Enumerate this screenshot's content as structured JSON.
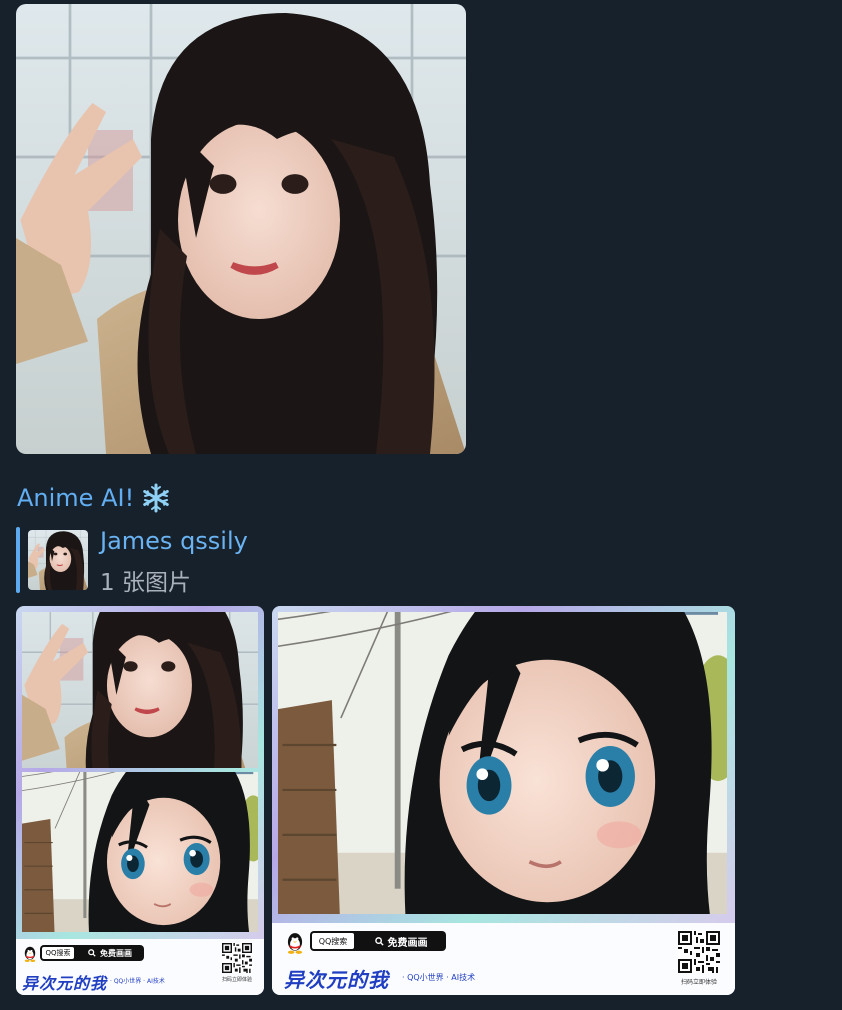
{
  "message": {
    "sender_name": "Anime AI!",
    "sender_emoji": "snowflake-icon"
  },
  "reply": {
    "author": "James qssily",
    "text": "1 张图片"
  },
  "card": {
    "pill_label": "QQ搜索",
    "pill_button": "免费画画",
    "brand": "异次元的我",
    "brand_sub": "· QQ小世界 · AI技术",
    "qr_label": "扫码立即体验"
  },
  "colors": {
    "background": "#17212b",
    "link": "#62aef2",
    "reply_bar": "#5eaaf0",
    "muted": "#a9b2bc",
    "brand": "#1f3ec2"
  }
}
